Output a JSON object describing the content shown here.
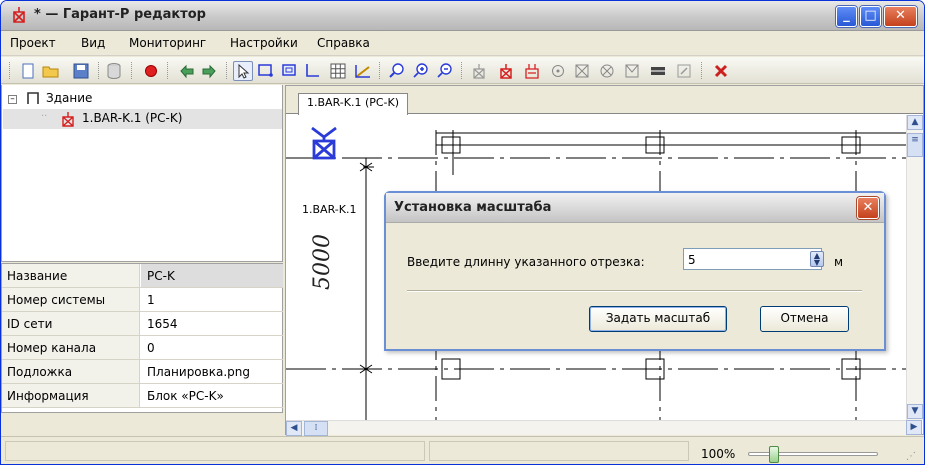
{
  "window": {
    "title": "* — Гарант-Р редактор",
    "minimize_glyph": "_",
    "maximize_glyph": "□",
    "close_glyph": "✕"
  },
  "menu": [
    "Проект",
    "Вид",
    "Мониторинг",
    "Настройки",
    "Справка"
  ],
  "toolbar": {
    "buttons": [
      "new-doc-icon",
      "open-folder-icon",
      "save-icon",
      "database-icon",
      "record-icon",
      "undo-icon",
      "redo-icon",
      "pointer-icon",
      "draw-wall-icon",
      "draw-room-icon",
      "draw-line-icon",
      "grid-icon",
      "measure-icon",
      "zoom-1-icon",
      "zoom-in-icon",
      "zoom-out-icon",
      "device-icon",
      "device-red-icon",
      "device-panel-icon",
      "sensor-circle-icon",
      "sensor-square-icon",
      "sensor-x-icon",
      "sensor-triangle-icon",
      "block-icon",
      "edit-icon",
      "delete-icon"
    ],
    "active_button": "pointer-icon"
  },
  "tree": {
    "root_label": "Здание",
    "child_label": "1.BAR-K.1 (PC-K)"
  },
  "properties": [
    {
      "name": "Название",
      "value": "PC-K"
    },
    {
      "name": "Номер системы",
      "value": "1"
    },
    {
      "name": "ID сети",
      "value": "1654"
    },
    {
      "name": "Номер канала",
      "value": "0"
    },
    {
      "name": "Подложка",
      "value": "Планировка.png"
    },
    {
      "name": "Информация",
      "value": "Блок «PC-K»"
    }
  ],
  "tab": {
    "label": "1.BAR-K.1 (PC-K)"
  },
  "drawing": {
    "device_label": "1.BAR-K.1",
    "dimension_label": "5000"
  },
  "dialog": {
    "title": "Установка масштаба",
    "prompt": "Введите длинну указанного отрезка:",
    "length_value": "5",
    "unit": "м",
    "apply_label": "Задать масштаб",
    "cancel_label": "Отмена",
    "close_glyph": "✕"
  },
  "status": {
    "zoom_text": "100%",
    "zoom_level": 0.1
  },
  "colors": {
    "device": "#2a3bd8",
    "icon_red": "#d62020",
    "accent_blue": "#0831d9"
  }
}
